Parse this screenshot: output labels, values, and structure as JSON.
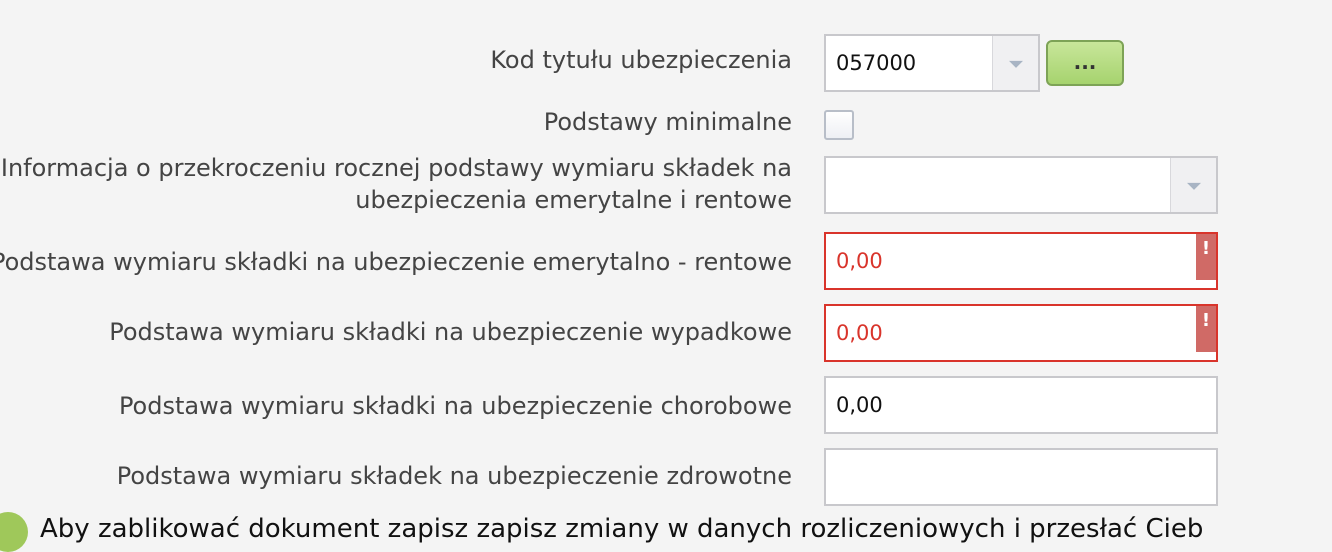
{
  "form": {
    "kod_tytulu": {
      "label": "Kod tytułu ubezpieczenia",
      "value": "057000",
      "button_label": "..."
    },
    "podstawy_minimalne": {
      "label": "Podstawy minimalne",
      "checked": false
    },
    "informacja_przekroczenie": {
      "label_line1": "Informacja o przekroczeniu rocznej podstawy wymiaru składek na",
      "label_line2": "ubezpieczenia emerytalne i rentowe",
      "value": ""
    },
    "podstawa_emerytalno_rentowe": {
      "label": "Podstawa wymiaru składki na ubezpieczenie emerytalno - rentowe",
      "value": "0,00",
      "error_mark": "!"
    },
    "podstawa_wypadkowe": {
      "label": "Podstawa wymiaru składki na ubezpieczenie wypadkowe",
      "value": "0,00",
      "error_mark": "!"
    },
    "podstawa_chorobowe": {
      "label": "Podstawa wymiaru składki na ubezpieczenie chorobowe",
      "value": "0,00"
    },
    "podstawa_zdrowotne": {
      "label": "Podstawa wymiaru składek na ubezpieczenie zdrowotne",
      "value": ""
    }
  },
  "bottom_message": "Aby zablikować dokument zapisz zapisz zmiany w danych rozliczeniowych i przesłać Cieb",
  "colors": {
    "error": "#d9342b",
    "accent_green": "#a6d36e",
    "background": "#f4f4f4"
  }
}
